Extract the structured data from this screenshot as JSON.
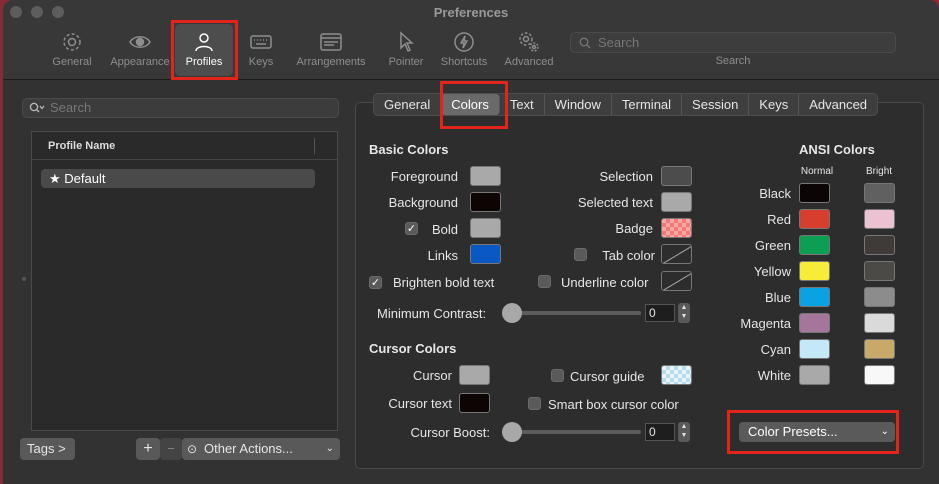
{
  "window": {
    "title": "Preferences"
  },
  "toolbar": {
    "items": [
      {
        "label": "General",
        "icon": "gear-icon"
      },
      {
        "label": "Appearance",
        "icon": "eye-icon"
      },
      {
        "label": "Profiles",
        "icon": "person-icon"
      },
      {
        "label": "Keys",
        "icon": "keyboard-icon"
      },
      {
        "label": "Arrangements",
        "icon": "window-icon"
      },
      {
        "label": "Pointer",
        "icon": "pointer-icon"
      },
      {
        "label": "Shortcuts",
        "icon": "bolt-icon"
      },
      {
        "label": "Advanced",
        "icon": "gears-icon"
      }
    ],
    "selected": "Profiles",
    "search_placeholder": "Search",
    "search_label": "Search"
  },
  "profiles": {
    "search_placeholder": "Search",
    "column_header": "Profile Name",
    "rows": [
      {
        "name": "Default",
        "starred": true
      }
    ],
    "tags_button": "Tags >",
    "add_button": "+",
    "remove_button": "−",
    "other_actions": "Other Actions..."
  },
  "tabs": {
    "items": [
      "General",
      "Colors",
      "Text",
      "Window",
      "Terminal",
      "Session",
      "Keys",
      "Advanced"
    ],
    "selected": "Colors"
  },
  "basic_colors": {
    "heading": "Basic Colors",
    "foreground": {
      "label": "Foreground",
      "color": "#a9a9a9"
    },
    "background": {
      "label": "Background",
      "color": "#0d0404"
    },
    "bold": {
      "label": "Bold",
      "checked": true,
      "color": "#a9a9a9"
    },
    "links": {
      "label": "Links",
      "color": "#0a58c4"
    },
    "selection": {
      "label": "Selection",
      "color": "#4c4c4c"
    },
    "selected_text": {
      "label": "Selected text",
      "color": "#a9a9a9"
    },
    "badge": {
      "label": "Badge",
      "color": "#f07a78"
    },
    "tab_color": {
      "label": "Tab color",
      "checked": false
    },
    "brighten_bold": {
      "label": "Brighten bold text",
      "checked": true
    },
    "underline_color": {
      "label": "Underline color",
      "checked": false
    },
    "min_contrast": {
      "label": "Minimum Contrast:",
      "value": "0"
    }
  },
  "cursor_colors": {
    "heading": "Cursor Colors",
    "cursor": {
      "label": "Cursor",
      "color": "#a9a9a9"
    },
    "cursor_text": {
      "label": "Cursor text",
      "color": "#0d0404"
    },
    "cursor_guide": {
      "label": "Cursor guide",
      "checked": false,
      "color": "#b7dcea"
    },
    "smart_box": {
      "label": "Smart box cursor color",
      "checked": false
    },
    "cursor_boost": {
      "label": "Cursor Boost:",
      "value": "0"
    }
  },
  "ansi": {
    "heading": "ANSI Colors",
    "normal_header": "Normal",
    "bright_header": "Bright",
    "rows": [
      {
        "name": "Black",
        "normal": "#0b0505",
        "bright": "#606060"
      },
      {
        "name": "Red",
        "normal": "#d83e2e",
        "bright": "#ebc2d2"
      },
      {
        "name": "Green",
        "normal": "#0c9e52",
        "bright": "#403a38"
      },
      {
        "name": "Yellow",
        "normal": "#f7ec37",
        "bright": "#4c4a46"
      },
      {
        "name": "Blue",
        "normal": "#0aa2e2",
        "bright": "#8c8c8c"
      },
      {
        "name": "Magenta",
        "normal": "#a6759c",
        "bright": "#dadada"
      },
      {
        "name": "Cyan",
        "normal": "#c5e8f7",
        "bright": "#c9a96a"
      },
      {
        "name": "White",
        "normal": "#a9a9a9",
        "bright": "#f8f8f8"
      }
    ]
  },
  "presets": {
    "label": "Color Presets..."
  }
}
